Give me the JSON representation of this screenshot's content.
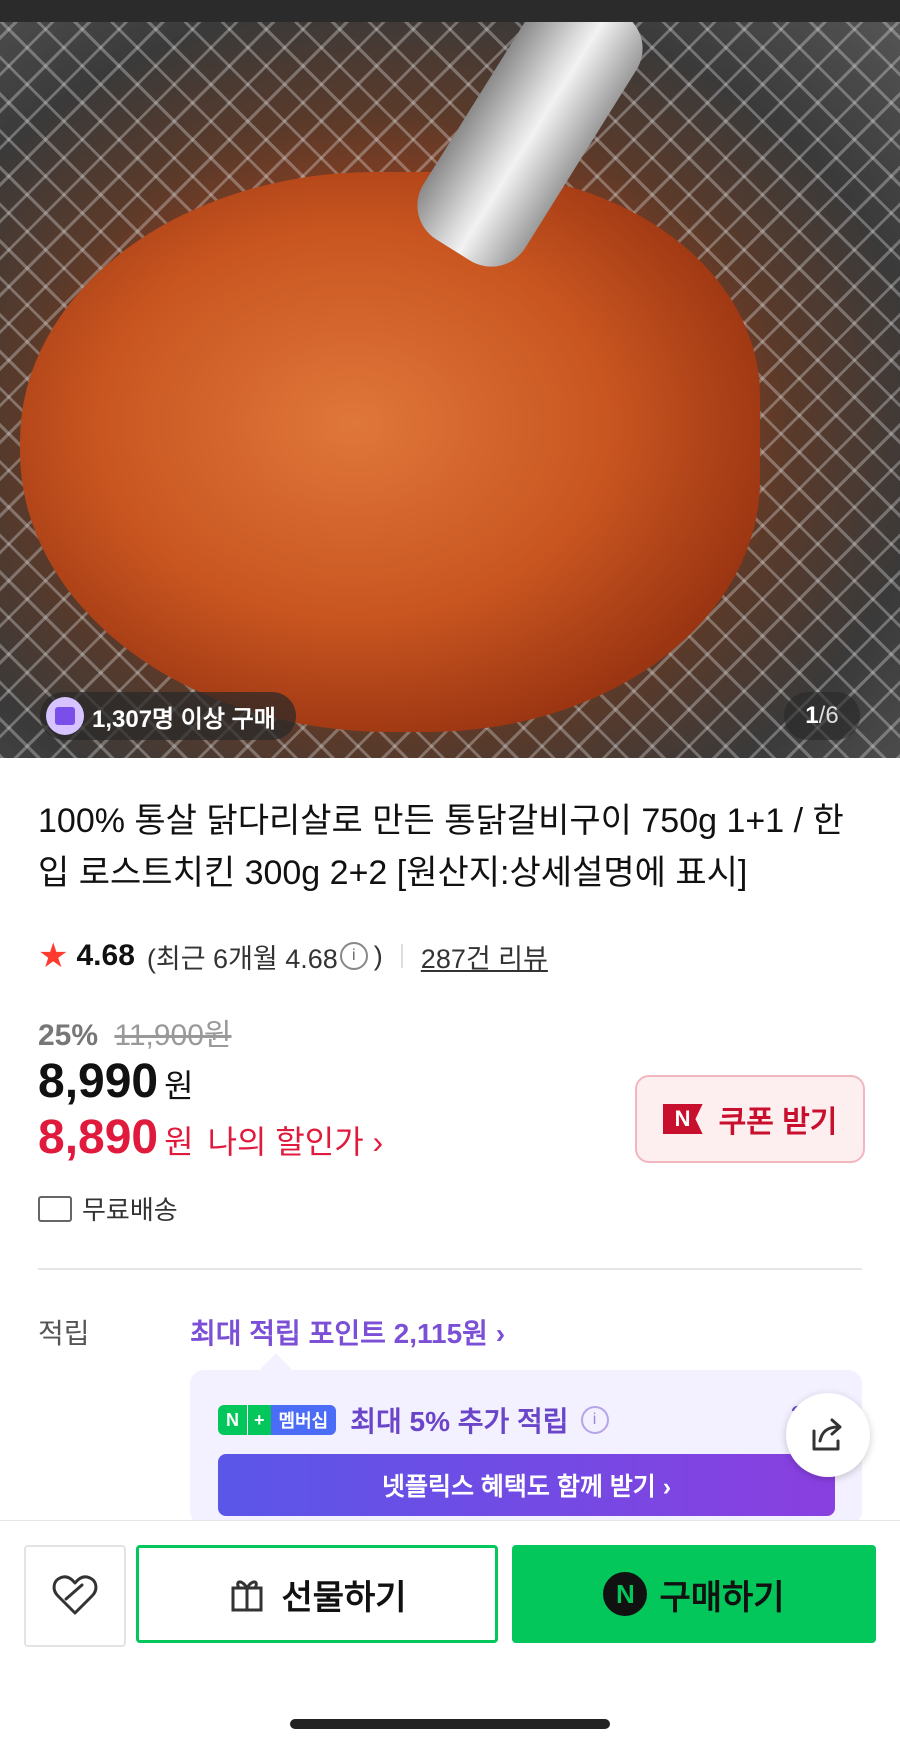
{
  "hero": {
    "buyers_label": "1,307명 이상 구매",
    "page_current": "1",
    "page_separator": "/",
    "page_total": "6"
  },
  "product": {
    "title": "100% 통살 닭다리살로 만든 통닭갈비구이 750g 1+1 / 한입 로스트치킨 300g 2+2 [원산지:상세설명에 표시]",
    "rating": "4.68",
    "recent_rating_label": "(최근 6개월 4.68",
    "recent_rating_close": ")",
    "review_link": "287건 리뷰",
    "discount_percent": "25%",
    "original_price": "11,900원",
    "price": "8,990",
    "price_unit": "원",
    "my_price": "8,890",
    "my_price_unit": "원",
    "my_price_label": "나의 할인가 ›",
    "coupon_badge": "N",
    "coupon_label": "쿠폰 받기",
    "shipping": "무료배송"
  },
  "reward": {
    "label": "적립",
    "max_points_link": "최대 적립 포인트 2,115원 ›",
    "membership_n": "N",
    "membership_plus": "+",
    "membership_word": "멤버십",
    "membership_text": "최대 5% 추가 적립",
    "membership_points": "35",
    "netflix_button": "넷플릭스 혜택도 함께 받기 ›"
  },
  "actions": {
    "gift_label": "선물하기",
    "buy_n": "N",
    "buy_label": "구매하기"
  },
  "colors": {
    "naver_green": "#03c75a",
    "price_red": "#e01a3c",
    "reward_purple": "#7b4fd6"
  },
  "icons": [
    "shopping-bag-icon",
    "star-icon",
    "info-icon",
    "truck-icon",
    "share-icon",
    "heart-icon",
    "gift-icon"
  ]
}
